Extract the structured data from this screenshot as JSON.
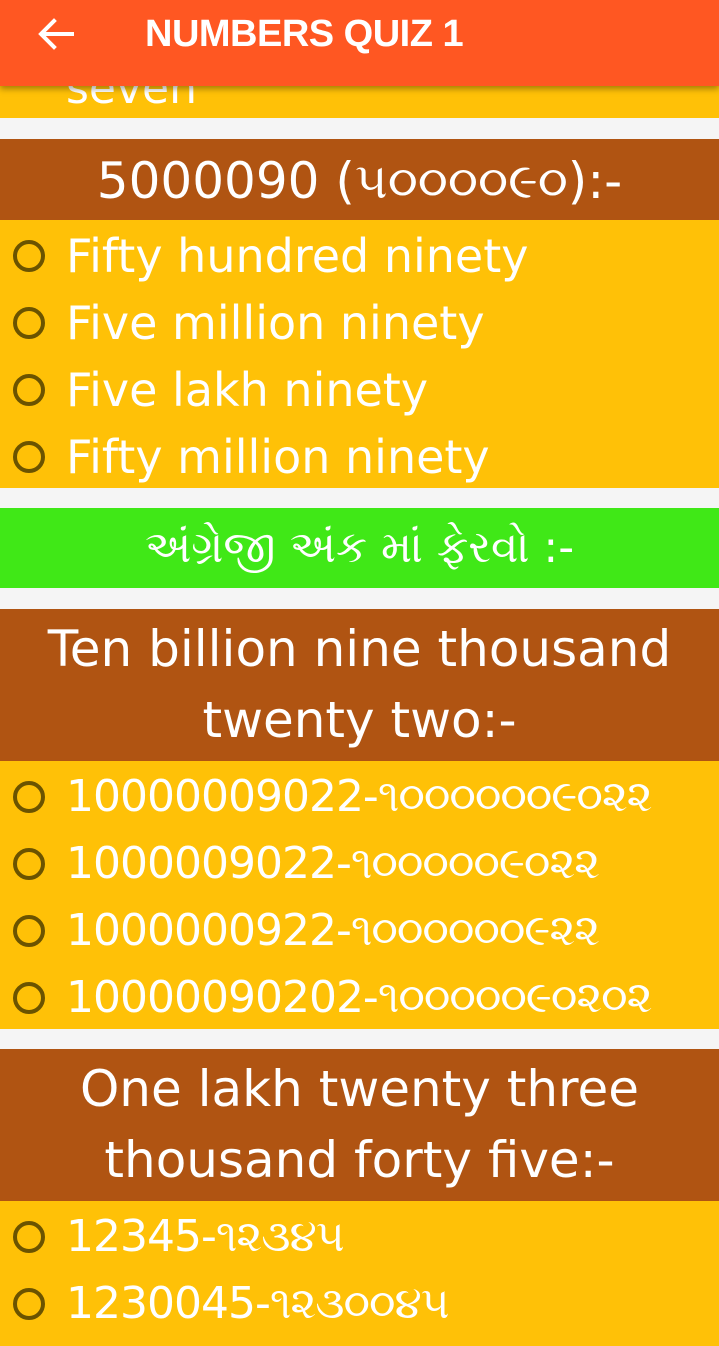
{
  "appbar": {
    "title": "NUMBERS QUIZ 1",
    "back_icon": "arrow-left-icon"
  },
  "previous_option_partial": "seven",
  "questions": [
    {
      "title": "5000090 (૫૦૦૦૦૯૦):-",
      "options": [
        "Fifty hundred ninety",
        "Five million ninety",
        "Five lakh ninety",
        "Fifty million ninety"
      ]
    },
    {
      "title_line1": "Ten billion nine thousand",
      "title_line2": "twenty two:-",
      "options": [
        "10000009022-૧૦૦૦૦૦૦૯૦૨૨",
        "1000009022-૧૦૦૦૦૦૯૦૨૨",
        "1000000922-૧૦૦૦૦૦૦૯૨૨",
        "10000090202-૧૦૦૦૦૦૯૦૨૦૨"
      ]
    },
    {
      "title_line1": "One lakh twenty three",
      "title_line2": "thousand forty five:-",
      "options": [
        "12345-૧૨૩૪૫",
        "1230045-૧૨૩૦૦૪૫"
      ]
    }
  ],
  "section_banner": "અંગ્રેજી અંક માં ફેરવો :-",
  "colors": {
    "appbar": "#ff5722",
    "question_header": "#b05412",
    "options_bg": "#ffc107",
    "banner": "#40e817",
    "radio_border": "#6b5300"
  }
}
